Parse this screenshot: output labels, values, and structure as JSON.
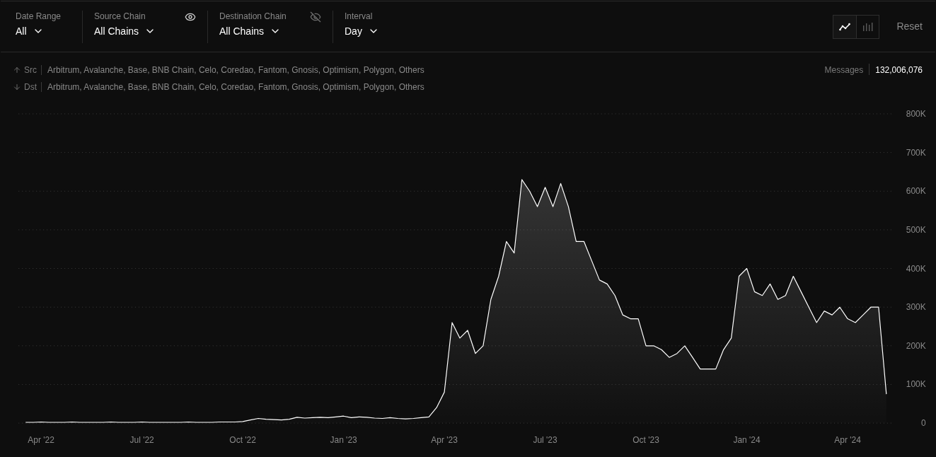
{
  "filters": [
    {
      "label": "Date Range",
      "value": "All"
    },
    {
      "label": "Source Chain",
      "value": "All Chains",
      "visible": true
    },
    {
      "label": "Destination Chain",
      "value": "All Chains",
      "visible": false
    },
    {
      "label": "Interval",
      "value": "Day"
    }
  ],
  "chart_types": [
    {
      "kind": "line",
      "selected": true
    },
    {
      "kind": "bar",
      "selected": false
    }
  ],
  "reset_button": "Reset",
  "legend": [
    {
      "kind": "up",
      "label": "Src",
      "chains": "Arbitrum, Avalanche, Base, BNB Chain, Celo, Coredao, Fantom, Gnosis, Optimism, Polygon, Others"
    },
    {
      "kind": "down",
      "label": "Dst",
      "chains": "Arbitrum, Avalanche, Base, BNB Chain, Celo, Coredao, Fantom, Gnosis, Optimism, Polygon, Others"
    }
  ],
  "total": {
    "label": "Messages",
    "value": "132,006,076"
  },
  "chart_data": {
    "type": "area",
    "categories": [
      null,
      null,
      "Apr '22",
      null,
      null,
      null,
      null,
      null,
      null,
      null,
      null,
      null,
      null,
      null,
      null,
      "Jul '22",
      null,
      null,
      null,
      null,
      null,
      null,
      null,
      null,
      null,
      null,
      null,
      null,
      "Oct '22",
      null,
      null,
      null,
      null,
      null,
      null,
      null,
      null,
      null,
      null,
      null,
      null,
      "Jan '23",
      null,
      null,
      null,
      null,
      null,
      null,
      null,
      null,
      null,
      null,
      null,
      null,
      "Apr '23",
      null,
      null,
      null,
      null,
      null,
      null,
      null,
      null,
      null,
      null,
      null,
      null,
      "Jul '23",
      null,
      null,
      null,
      null,
      null,
      null,
      null,
      null,
      null,
      null,
      null,
      null,
      "Oct '23",
      null,
      null,
      null,
      null,
      null,
      null,
      null,
      null,
      null,
      null,
      null,
      null,
      "Jan '24",
      null,
      null,
      null,
      null,
      null,
      null,
      null,
      null,
      null,
      null,
      null,
      null,
      "Apr '24",
      null,
      null,
      null,
      null,
      null
    ],
    "series": [
      {
        "color": "#ffffff",
        "values": [
          2,
          2,
          3,
          2,
          2,
          2,
          3,
          2,
          2,
          2,
          2,
          3,
          2,
          2,
          2,
          3,
          2,
          2,
          2,
          2,
          2,
          3,
          2,
          2,
          2,
          3,
          3,
          3,
          4,
          8,
          12,
          10,
          9,
          8,
          10,
          15,
          13,
          14,
          15,
          14,
          16,
          18,
          14,
          16,
          15,
          13,
          12,
          14,
          12,
          11,
          12,
          14,
          16,
          40,
          80,
          260,
          220,
          240,
          180,
          200,
          320,
          380,
          470,
          440,
          630,
          600,
          560,
          610,
          560,
          620,
          560,
          470,
          470,
          420,
          370,
          360,
          330,
          280,
          270,
          270,
          200,
          200,
          190,
          170,
          180,
          200,
          170,
          140,
          140,
          140,
          190,
          220,
          380,
          400,
          340,
          330,
          360,
          320,
          330,
          380,
          340,
          300,
          260,
          290,
          280,
          300,
          270,
          260,
          280,
          300,
          300,
          75
        ]
      }
    ],
    "ylim": [
      0,
      800
    ],
    "grid": true,
    "yticks": [
      {
        "value": 0,
        "label": "0"
      },
      {
        "value": 100,
        "label": "100K"
      },
      {
        "value": 200,
        "label": "200K"
      },
      {
        "value": 300,
        "label": "300K"
      },
      {
        "value": 400,
        "label": "400K"
      },
      {
        "value": 500,
        "label": "500K"
      },
      {
        "value": 600,
        "label": "600K"
      },
      {
        "value": 700,
        "label": "700K"
      },
      {
        "value": 800,
        "label": "800K"
      }
    ]
  }
}
